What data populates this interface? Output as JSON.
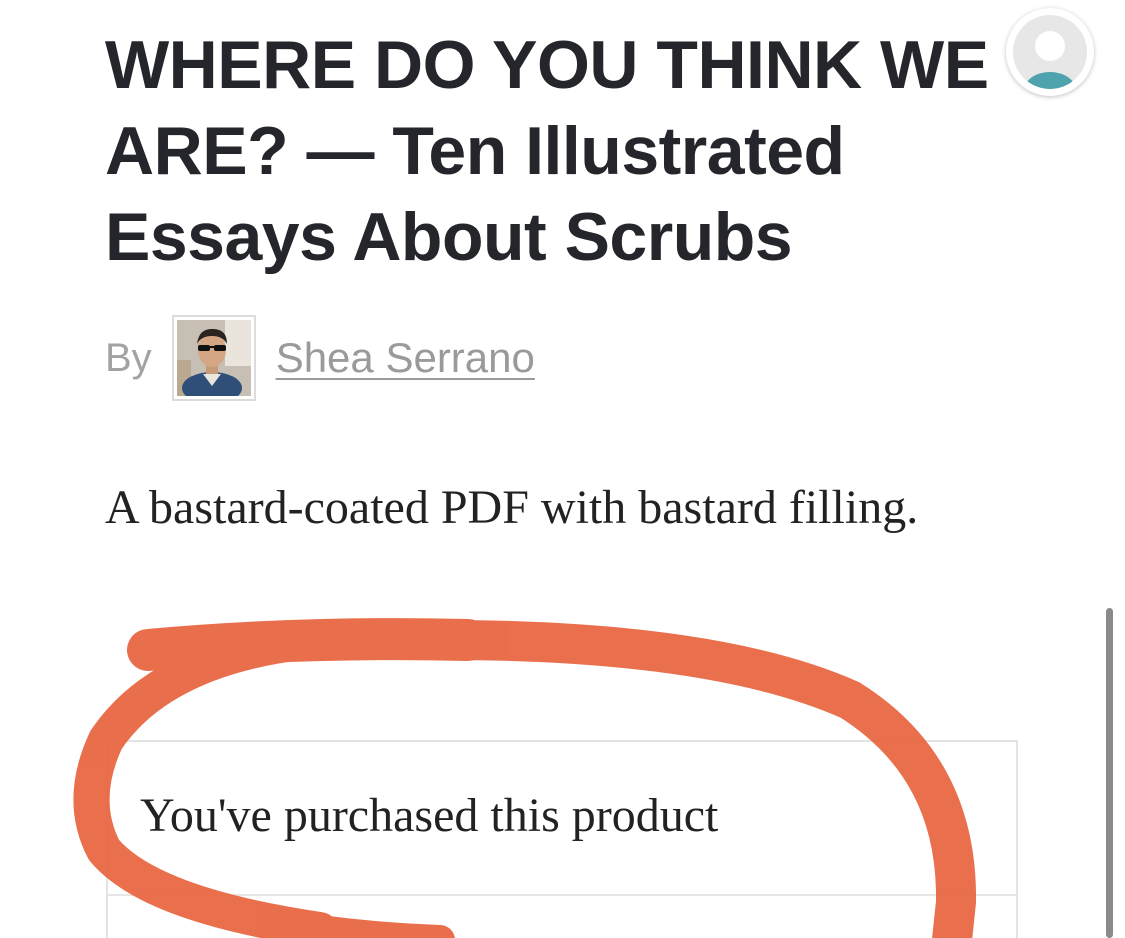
{
  "article": {
    "title": "WHERE DO YOU THINK WE ARE? — Ten Illustrated Essays About Scrubs",
    "byline_prefix": "By",
    "author_name": "Shea Serrano",
    "summary": "A bastard-coated PDF with bastard filling."
  },
  "purchase": {
    "status_text": "You've purchased this product"
  },
  "icons": {
    "account": "user-avatar-icon",
    "author": "author-photo"
  },
  "colors": {
    "title": "#24262b",
    "muted_text": "#9a9a9a",
    "body_text": "#222222",
    "annotation": "#e8653f",
    "avatar_accent": "#4fa3ae"
  }
}
